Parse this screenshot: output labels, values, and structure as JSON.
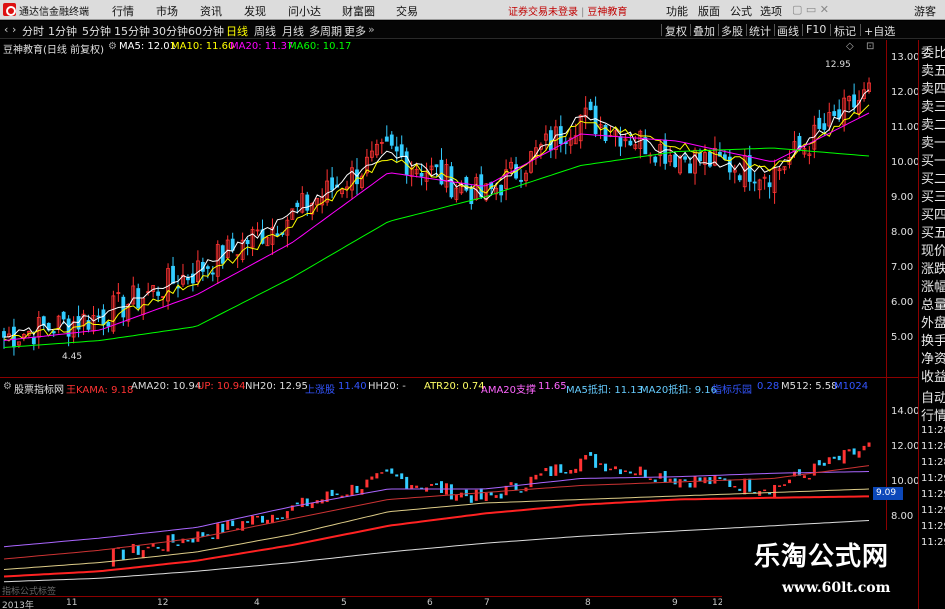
{
  "app": {
    "title": "通达信金融终端",
    "menus": [
      "行情",
      "市场",
      "资讯",
      "发现",
      "问小达",
      "财富圈",
      "交易"
    ],
    "login_notice": "证券交易未登录",
    "broker": "豆神教育",
    "right_menus": [
      "功能",
      "版面",
      "公式",
      "选项"
    ],
    "guest": "游客"
  },
  "period_bar": {
    "tabs": [
      "分时",
      "1分钟",
      "5分钟",
      "15分钟",
      "30分钟",
      "60分钟",
      "日线",
      "周线",
      "月线",
      "多周期",
      "更多"
    ],
    "active": "日线",
    "tools": [
      "复权",
      "叠加",
      "多股",
      "统计",
      "画线",
      "F10",
      "标记",
      "+自选"
    ]
  },
  "main_chart": {
    "stock_title": "豆神教育(日线 前复权)",
    "ma": [
      {
        "label": "MA5: 12.01",
        "color": "#ffffff"
      },
      {
        "label": "MA10: 11.60",
        "color": "#ffff00"
      },
      {
        "label": "MA20: 11.37",
        "color": "#ff00ff"
      },
      {
        "label": "MA60: 10.17",
        "color": "#00ff00"
      }
    ],
    "y_ticks": [
      "13.00",
      "12.00",
      "11.00",
      "10.00",
      "9.00",
      "8.00",
      "7.00",
      "6.00",
      "5.00"
    ],
    "high_label": "12.95",
    "low_label": "4.45"
  },
  "indicator_chart": {
    "name": "股票指标网",
    "items": [
      {
        "label": "王KAMA: 9.18",
        "color": "#ff3333"
      },
      {
        "label": "AMA20: 10.94",
        "color": "#dddddd"
      },
      {
        "label": "UP: 10.94",
        "color": "#ff3333"
      },
      {
        "label": "NH20: 12.95",
        "color": "#dddddd"
      },
      {
        "label": "上涨股",
        "color": "#3355ff"
      },
      {
        "label": "11.40",
        "color": "#3355ff"
      },
      {
        "label": "HH20: -",
        "color": "#dddddd"
      },
      {
        "label": "ATR20: 0.74",
        "color": "#ffff66"
      },
      {
        "label": "AMA20支撑",
        "color": "#ff66ff"
      },
      {
        "label": "11.65",
        "color": "#ff66ff"
      },
      {
        "label": "MA5抵扣: 11.13",
        "color": "#66ccff"
      },
      {
        "label": "MA20抵扣: 9.16",
        "color": "#66ccff"
      },
      {
        "label": "指标乐园",
        "color": "#3355ff"
      },
      {
        "label": "0.28",
        "color": "#3355ff"
      },
      {
        "label": "M512: 5.58",
        "color": "#dddddd"
      },
      {
        "label": "M1024",
        "color": "#3355ff"
      }
    ],
    "y_ticks": [
      "14.00",
      "12.00",
      "10.00",
      "8.00"
    ],
    "last_value": "9.09",
    "footer": "指标公式标签"
  },
  "x_axis": [
    "2013年",
    "11",
    "12",
    "4",
    "5",
    "6",
    "7",
    "8",
    "9",
    "12"
  ],
  "right_panel": {
    "quote": [
      "委比",
      "卖五",
      "卖四",
      "卖三",
      "卖二",
      "卖一",
      "买一",
      "买二",
      "买三",
      "买四",
      "买五",
      "现价",
      "涨跌",
      "涨幅",
      "总量",
      "外盘",
      "换手",
      "净资",
      "收益"
    ],
    "lower": [
      "自动",
      "行情",
      "11:28",
      "11:28",
      "11:28",
      "11:29",
      "11:29",
      "11:29",
      "11:29",
      "11:29"
    ]
  },
  "watermark": {
    "title": "乐淘公式网",
    "url": "www.60lt.com"
  },
  "colors": {
    "up": "#ff3333",
    "down": "#33ccff",
    "ma5": "#ffffff",
    "ma10": "#ffff00",
    "ma20": "#ff00ff",
    "ma60": "#00ff00",
    "grid": "#8b0000"
  },
  "chart_data": {
    "type": "line",
    "title": "豆神教育(日线 前复权)",
    "xlabel": "",
    "ylabel": "",
    "ylim": [
      4.4,
      13.4
    ],
    "x": [
      "2013年",
      "11",
      "12",
      "4",
      "5",
      "6",
      "7",
      "8",
      "9",
      "12"
    ],
    "series": [
      {
        "name": "MA5",
        "values": [
          5.0,
          5.6,
          6.9,
          8.5,
          10.3,
          9.0,
          11.3,
          10.2,
          9.7,
          12.0
        ]
      },
      {
        "name": "MA10",
        "values": [
          4.9,
          5.4,
          6.6,
          8.2,
          10.1,
          9.2,
          11.1,
          10.5,
          9.8,
          11.6
        ]
      },
      {
        "name": "MA20",
        "values": [
          4.9,
          5.2,
          6.2,
          7.7,
          9.7,
          9.3,
          10.8,
          10.6,
          10.0,
          11.4
        ]
      },
      {
        "name": "MA60",
        "values": [
          4.7,
          4.9,
          5.3,
          6.7,
          8.3,
          9.0,
          9.9,
          10.3,
          10.4,
          10.17
        ]
      }
    ]
  }
}
